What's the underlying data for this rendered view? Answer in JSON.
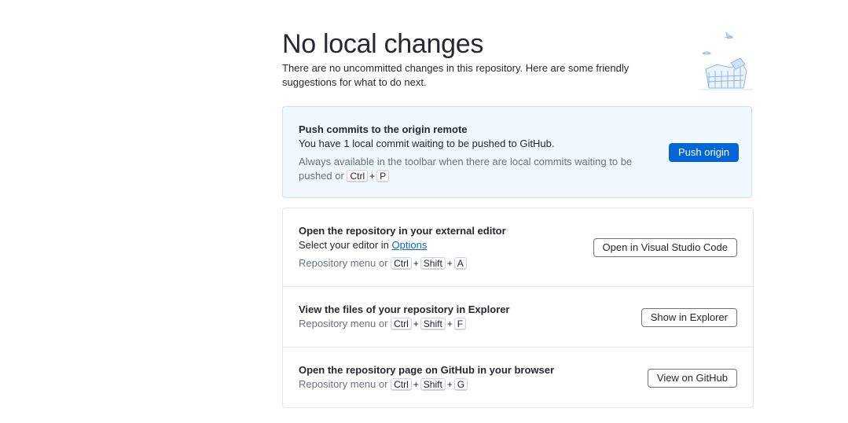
{
  "header": {
    "title": "No local changes",
    "subtitle": "There are no uncommitted changes in this repository. Here are some friendly suggestions for what to do next."
  },
  "push": {
    "title": "Push commits to the origin remote",
    "description": "You have 1 local commit waiting to be pushed to GitHub.",
    "hint": "Always available in the toolbar when there are local commits waiting to be pushed or",
    "shortcut": [
      "Ctrl",
      "P"
    ],
    "button": "Push origin"
  },
  "editor": {
    "title": "Open the repository in your external editor",
    "description_prefix": "Select your editor in",
    "options_link": "Options",
    "hint": "Repository menu or",
    "shortcut": [
      "Ctrl",
      "Shift",
      "A"
    ],
    "button": "Open in Visual Studio Code"
  },
  "explorer": {
    "title": "View the files of your repository in Explorer",
    "hint": "Repository menu or",
    "shortcut": [
      "Ctrl",
      "Shift",
      "F"
    ],
    "button": "Show in Explorer"
  },
  "github": {
    "title": "Open the repository page on GitHub in your browser",
    "hint": "Repository menu or",
    "shortcut": [
      "Ctrl",
      "Shift",
      "G"
    ],
    "button": "View on GitHub"
  },
  "plus": "+",
  "colors": {
    "accent": "#0366d6",
    "push_bg": "#f1f8ff",
    "border": "#e1e4e8",
    "muted": "#6a737d"
  },
  "icons": {
    "illustration": "empty-state-illustration"
  }
}
